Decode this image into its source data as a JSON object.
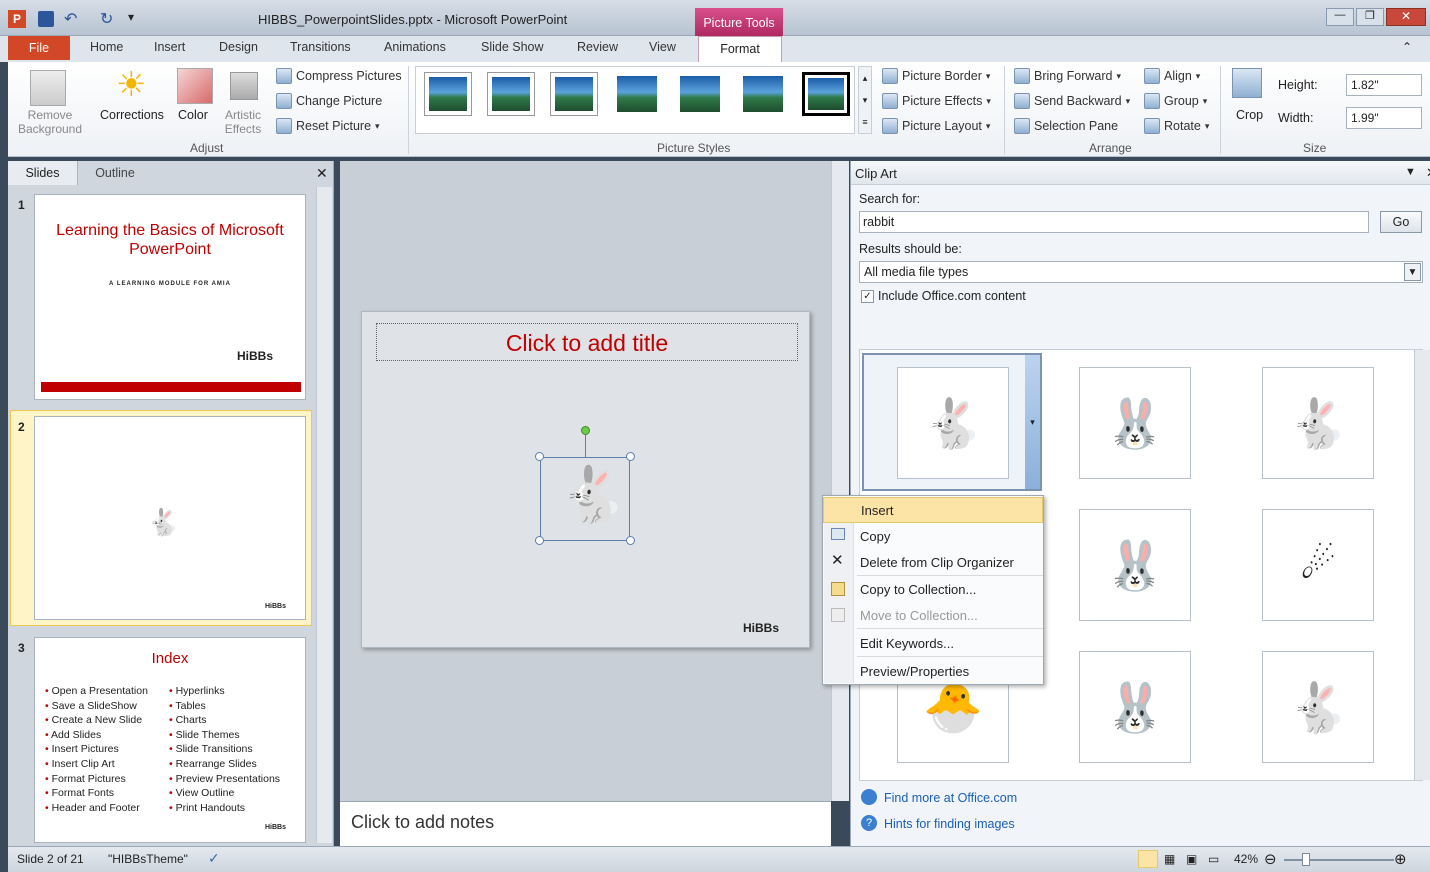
{
  "window": {
    "title": "HIBBS_PowerpointSlides.pptx - Microsoft PowerPoint",
    "context_tab": "Picture Tools"
  },
  "tabs": [
    "File",
    "Home",
    "Insert",
    "Design",
    "Transitions",
    "Animations",
    "Slide Show",
    "Review",
    "View",
    "Format"
  ],
  "ribbon": {
    "adjust": {
      "remove_bg": "Remove\nBackground",
      "corrections": "Corrections",
      "color": "Color",
      "artistic": "Artistic\nEffects",
      "compress": "Compress Pictures",
      "change": "Change Picture",
      "reset": "Reset Picture",
      "label": "Adjust"
    },
    "styles": {
      "label": "Picture Styles",
      "border": "Picture Border",
      "effects": "Picture Effects",
      "layout": "Picture Layout"
    },
    "arrange": {
      "bring_forward": "Bring Forward",
      "send_backward": "Send Backward",
      "selection_pane": "Selection Pane",
      "align": "Align",
      "group": "Group",
      "rotate": "Rotate",
      "label": "Arrange"
    },
    "size": {
      "crop": "Crop",
      "height_label": "Height:",
      "height": "1.82\"",
      "width_label": "Width:",
      "width": "1.99\"",
      "label": "Size"
    }
  },
  "leftpane": {
    "tab_slides": "Slides",
    "tab_outline": "Outline",
    "slide1": {
      "num": "1",
      "title": "Learning the Basics of Microsoft PowerPoint",
      "subtitle": "A LEARNING MODULE FOR AMIA",
      "logo": "HiBBs"
    },
    "slide2": {
      "num": "2",
      "logo": "HiBBs"
    },
    "slide3": {
      "num": "3",
      "title": "Index",
      "col1": [
        "Open a Presentation",
        "Save a SlideShow",
        "Create a New Slide",
        "Add Slides",
        "Insert Pictures",
        "Insert Clip Art",
        "Format Pictures",
        "Format Fonts",
        "Header and Footer"
      ],
      "col2": [
        "Hyperlinks",
        "Tables",
        "Charts",
        "Slide Themes",
        "Slide Transitions",
        "Rearrange Slides",
        "Preview Presentations",
        "View Outline",
        "Print Handouts"
      ],
      "logo": "HiBBs"
    }
  },
  "slide": {
    "title_placeholder": "Click to add title",
    "logo": "HiBBs"
  },
  "notes": {
    "placeholder": "Click to add notes"
  },
  "clipart": {
    "pane_title": "Clip Art",
    "search_label": "Search for:",
    "search_value": "rabbit",
    "go": "Go",
    "results_label": "Results should be:",
    "results_value": "All media file types",
    "include": "Include Office.com content",
    "find_more": "Find more at Office.com",
    "hints": "Hints for finding images"
  },
  "context_menu": {
    "items": [
      "Insert",
      "Copy",
      "Delete from Clip Organizer",
      "Copy to Collection...",
      "Move to Collection...",
      "Edit Keywords...",
      "Preview/Properties"
    ]
  },
  "status": {
    "slide": "Slide 2 of 21",
    "theme": "\"HIBBsTheme\"",
    "zoom": "42%"
  },
  "colors": {
    "file_tab": "#d24726",
    "picture_tools": "#c0306a",
    "slide_title": "#c00000"
  }
}
